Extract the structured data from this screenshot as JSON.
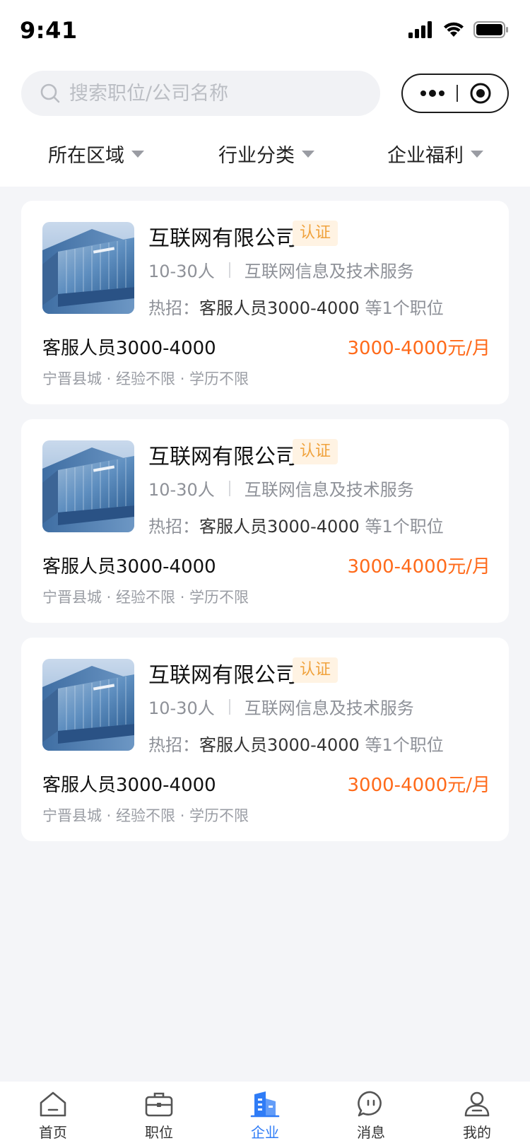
{
  "status_bar": {
    "time": "9:41"
  },
  "search": {
    "placeholder": "搜索职位/公司名称",
    "value": ""
  },
  "filters": [
    {
      "label": "所在区域"
    },
    {
      "label": "行业分类"
    },
    {
      "label": "企业福利"
    }
  ],
  "companies": [
    {
      "name": "互联网有限公司",
      "badge": "认证",
      "size": "10-30人",
      "industry": "互联网信息及技术服务",
      "hot_prefix": "热招：",
      "hot_job": "客服人员3000-4000",
      "hot_suffix": " 等1个职位",
      "job_title": "客服人员3000-4000",
      "salary": "3000-4000元/月",
      "job_tags": "宁晋县城 · 经验不限 · 学历不限"
    },
    {
      "name": "互联网有限公司",
      "badge": "认证",
      "size": "10-30人",
      "industry": "互联网信息及技术服务",
      "hot_prefix": "热招：",
      "hot_job": "客服人员3000-4000",
      "hot_suffix": " 等1个职位",
      "job_title": "客服人员3000-4000",
      "salary": "3000-4000元/月",
      "job_tags": "宁晋县城 · 经验不限 · 学历不限"
    },
    {
      "name": "互联网有限公司",
      "badge": "认证",
      "size": "10-30人",
      "industry": "互联网信息及技术服务",
      "hot_prefix": "热招：",
      "hot_job": "客服人员3000-4000",
      "hot_suffix": " 等1个职位",
      "job_title": "客服人员3000-4000",
      "salary": "3000-4000元/月",
      "job_tags": "宁晋县城 · 经验不限 · 学历不限"
    }
  ],
  "tabs": [
    {
      "label": "首页",
      "icon": "home-icon"
    },
    {
      "label": "职位",
      "icon": "briefcase-icon"
    },
    {
      "label": "企业",
      "icon": "building-icon",
      "active": true
    },
    {
      "label": "消息",
      "icon": "message-icon"
    },
    {
      "label": "我的",
      "icon": "user-icon"
    }
  ],
  "colors": {
    "accent": "#2f7cf6",
    "salary": "#ff6a1a",
    "badge_text": "#f0a23c",
    "badge_bg": "#fff3e3",
    "background": "#f4f5f8"
  }
}
